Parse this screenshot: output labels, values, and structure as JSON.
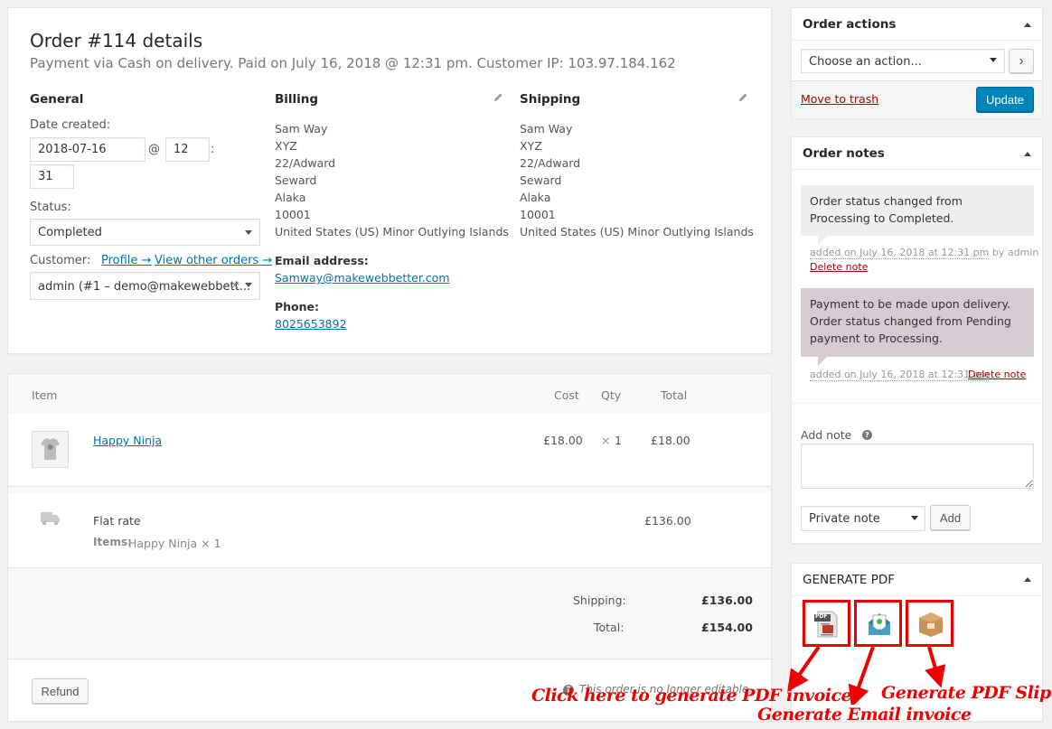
{
  "order": {
    "title": "Order #114 details",
    "subtitle": "Payment via Cash on delivery. Paid on July 16, 2018 @ 12:31 pm. Customer IP: 103.97.184.162"
  },
  "general": {
    "heading": "General",
    "date_label": "Date created:",
    "date_value": "2018-07-16",
    "at_sign": "@",
    "hour_value": "12",
    "colon": ":",
    "minute_value": "31",
    "status_label": "Status:",
    "status_value": "Completed",
    "customer_label": "Customer:",
    "profile_link": "Profile →",
    "other_orders_link": "View other orders →",
    "customer_value": "admin (#1 – demo@makewebbett...",
    "clear_x": "×"
  },
  "billing": {
    "heading": "Billing",
    "lines": [
      "Sam Way",
      "XYZ",
      "22/Adward",
      "Seward",
      "Alaka",
      "10001",
      "United States (US) Minor Outlying Islands"
    ],
    "email_label": "Email address:",
    "email_value": "Samway@makewebbetter.com",
    "phone_label": "Phone:",
    "phone_value": "8025653892"
  },
  "shipping": {
    "heading": "Shipping",
    "lines": [
      "Sam Way",
      "XYZ",
      "22/Adward",
      "Seward",
      "Alaka",
      "10001",
      "United States (US) Minor Outlying Islands"
    ]
  },
  "items": {
    "col_item": "Item",
    "col_cost": "Cost",
    "col_qty": "Qty",
    "col_total": "Total",
    "product_name": "Happy Ninja",
    "product_cost": "£18.00",
    "product_qty_x": "×",
    "product_qty": "1",
    "product_total": "£18.00",
    "shipping_method": "Flat rate",
    "shipping_items_label": "Items:",
    "shipping_items_value": "Happy Ninja × 1",
    "shipping_total": "£136.00",
    "totals_shipping_label": "Shipping:",
    "totals_shipping_value": "£136.00",
    "totals_total_label": "Total:",
    "totals_total_value": "£154.00",
    "refund_button": "Refund",
    "not_editable": "This order is no longer editable."
  },
  "order_actions": {
    "title": "Order actions",
    "select_value": "Choose an action...",
    "go_arrow": "›",
    "trash_link": "Move to trash",
    "update_button": "Update"
  },
  "order_notes": {
    "title": "Order notes",
    "notes": [
      {
        "text": "Order status changed from Processing to Completed.",
        "meta": "added on July 16, 2018 at 12:31 pm",
        "by": "by admin",
        "delete": "Delete note"
      },
      {
        "text": "Payment to be made upon delivery. Order status changed from Pending payment to Processing.",
        "meta": "added on July 16, 2018 at 12:31 pm",
        "delete": "Delete note"
      }
    ],
    "add_note_label": "Add note",
    "help_icon": "?",
    "note_type_value": "Private note",
    "add_button": "Add"
  },
  "generate_pdf": {
    "title": "GENERATE PDF",
    "pdf_badge": "PDF"
  },
  "annotations": {
    "pdf_invoice": "Click here to generate PDF invoice",
    "email_invoice": "Generate Email invoice",
    "pdf_slip": "Generate PDF Slip"
  },
  "colors": {
    "link": "#0073aa",
    "update_button": "#0085ba",
    "system_note": "#d7cad2",
    "customer_note": "#efefef",
    "annotation_red": "#e00000"
  }
}
